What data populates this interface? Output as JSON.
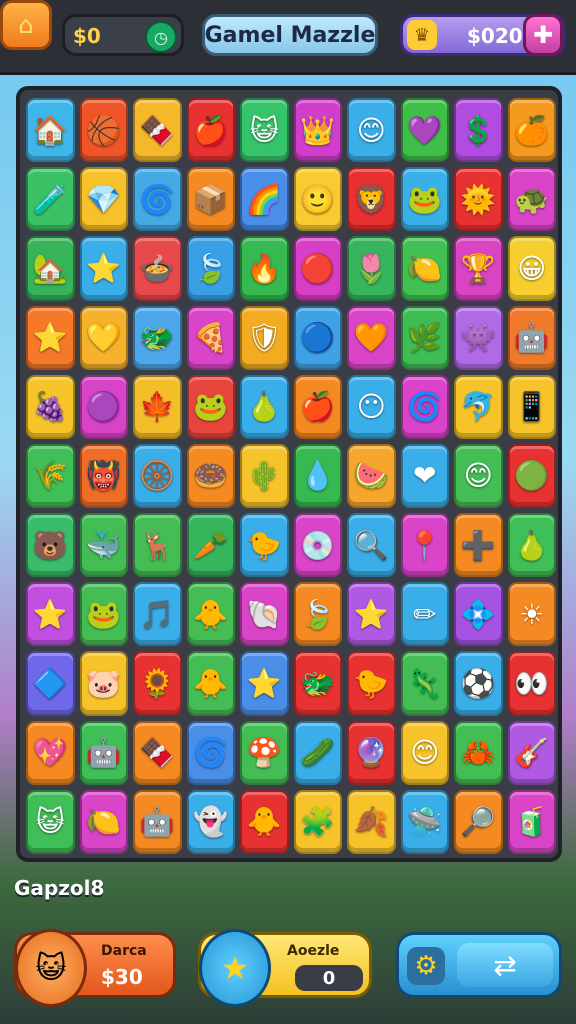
{
  "header": {
    "coins": "$0",
    "title": "Gamel Mazzle",
    "money": "$020"
  },
  "board": {
    "label": "Gapzol8",
    "tiles": [
      [
        "🏠",
        "🏀",
        "🍫",
        "🍎",
        "😺",
        "👑",
        "😊",
        "💜",
        "💲",
        "🍊"
      ],
      [
        "🧪",
        "💎",
        "🌀",
        "📦",
        "🌈",
        "🙂",
        "🦁",
        "🐸",
        "🌞",
        "🐢"
      ],
      [
        "🏡",
        "⭐",
        "🍲",
        "🍃",
        "🔥",
        "🔴",
        "🌷",
        "🍋",
        "🏆",
        "😀"
      ],
      [
        "⭐",
        "💛",
        "🐲",
        "🍕",
        "🛡",
        "🔵",
        "🧡",
        "🌿",
        "👾",
        "🤖"
      ],
      [
        "🍇",
        "🟣",
        "🍁",
        "🐸",
        "🍐",
        "🍎",
        "😶",
        "🌀",
        "🐬",
        "📱"
      ],
      [
        "🌾",
        "👹",
        "🛞",
        "🍩",
        "🌵",
        "💧",
        "🍉",
        "❤",
        "😊",
        "🟢"
      ],
      [
        "🐻",
        "🐳",
        "🦌",
        "🥕",
        "🐤",
        "💿",
        "🔍",
        "📍",
        "➕",
        "🍐"
      ],
      [
        "⭐",
        "🐸",
        "🎵",
        "🐥",
        "🐚",
        "🍃",
        "⭐",
        "✏",
        "💠",
        "☀"
      ],
      [
        "🔷",
        "🐷",
        "🌻",
        "🐥",
        "⭐",
        "🐲",
        "🐤",
        "🦎",
        "⚽",
        "👀"
      ],
      [
        "💖",
        "🤖",
        "🍫",
        "🌀",
        "🍄",
        "🥒",
        "🔮",
        "😊",
        "🦀",
        "🎸"
      ],
      [
        "😺",
        "🍋",
        "🤖",
        "👻",
        "🐥",
        "🧩",
        "🍂",
        "🛸",
        "🔎",
        "🧃"
      ]
    ],
    "colors": [
      [
        "#3fb6ea",
        "#f0552a",
        "#f6b82b",
        "#e83232",
        "#35c46a",
        "#d13ecb",
        "#3aaee8",
        "#3fbf4a",
        "#b04ce0",
        "#f59a1e"
      ],
      [
        "#3bc165",
        "#f7c12c",
        "#45a9e6",
        "#f58a22",
        "#4a8ee8",
        "#f8cb33",
        "#e83030",
        "#3ab0e9",
        "#e83232",
        "#d944c9"
      ],
      [
        "#37b35a",
        "#3aaee8",
        "#e8494a",
        "#3aa0e6",
        "#35b950",
        "#d83ec6",
        "#36b55c",
        "#42c053",
        "#d844c2",
        "#f6cf2e"
      ],
      [
        "#f6792a",
        "#f6b12d",
        "#4ca8ea",
        "#d944c9",
        "#f3ac22",
        "#3fa2e5",
        "#d944c9",
        "#3fbd55",
        "#b16ae6",
        "#f07a2a"
      ],
      [
        "#f6c42a",
        "#d744c8",
        "#f6bd2b",
        "#e8453e",
        "#3aaee8",
        "#f58a22",
        "#3aaee8",
        "#d944c9",
        "#f6c42a",
        "#f6c42a"
      ],
      [
        "#40be57",
        "#f06d28",
        "#3aaee8",
        "#f58a22",
        "#f6c42a",
        "#35b950",
        "#f6a62c",
        "#3aaee8",
        "#45bd55",
        "#e83232"
      ],
      [
        "#3bbc6a",
        "#45bd55",
        "#45bd55",
        "#36b55c",
        "#3aaee8",
        "#d944c9",
        "#3aaee8",
        "#d944c9",
        "#f58a22",
        "#40be57"
      ],
      [
        "#c150e0",
        "#45bd55",
        "#3aaee8",
        "#45bd55",
        "#d944c9",
        "#f58a22",
        "#b05ae4",
        "#3aaee8",
        "#a453e2",
        "#f58a22"
      ],
      [
        "#6f68ea",
        "#f6c42a",
        "#e83232",
        "#45bd55",
        "#4a8ee8",
        "#e83232",
        "#e83232",
        "#45bd55",
        "#3aaee8",
        "#e83232"
      ],
      [
        "#f58a22",
        "#40be57",
        "#f58a22",
        "#4a8ee8",
        "#45bd55",
        "#3aaee8",
        "#e83232",
        "#f6c42a",
        "#45bd55",
        "#b05ae4"
      ],
      [
        "#40be57",
        "#d944c9",
        "#f58a22",
        "#3aaee8",
        "#e83232",
        "#f6c42a",
        "#f6c42a",
        "#3aaee8",
        "#f58a22",
        "#d944c9"
      ]
    ]
  },
  "bottom": {
    "left_title": "Darca",
    "left_value": "$30",
    "mid_title": "Aoezle",
    "mid_value": "0"
  }
}
